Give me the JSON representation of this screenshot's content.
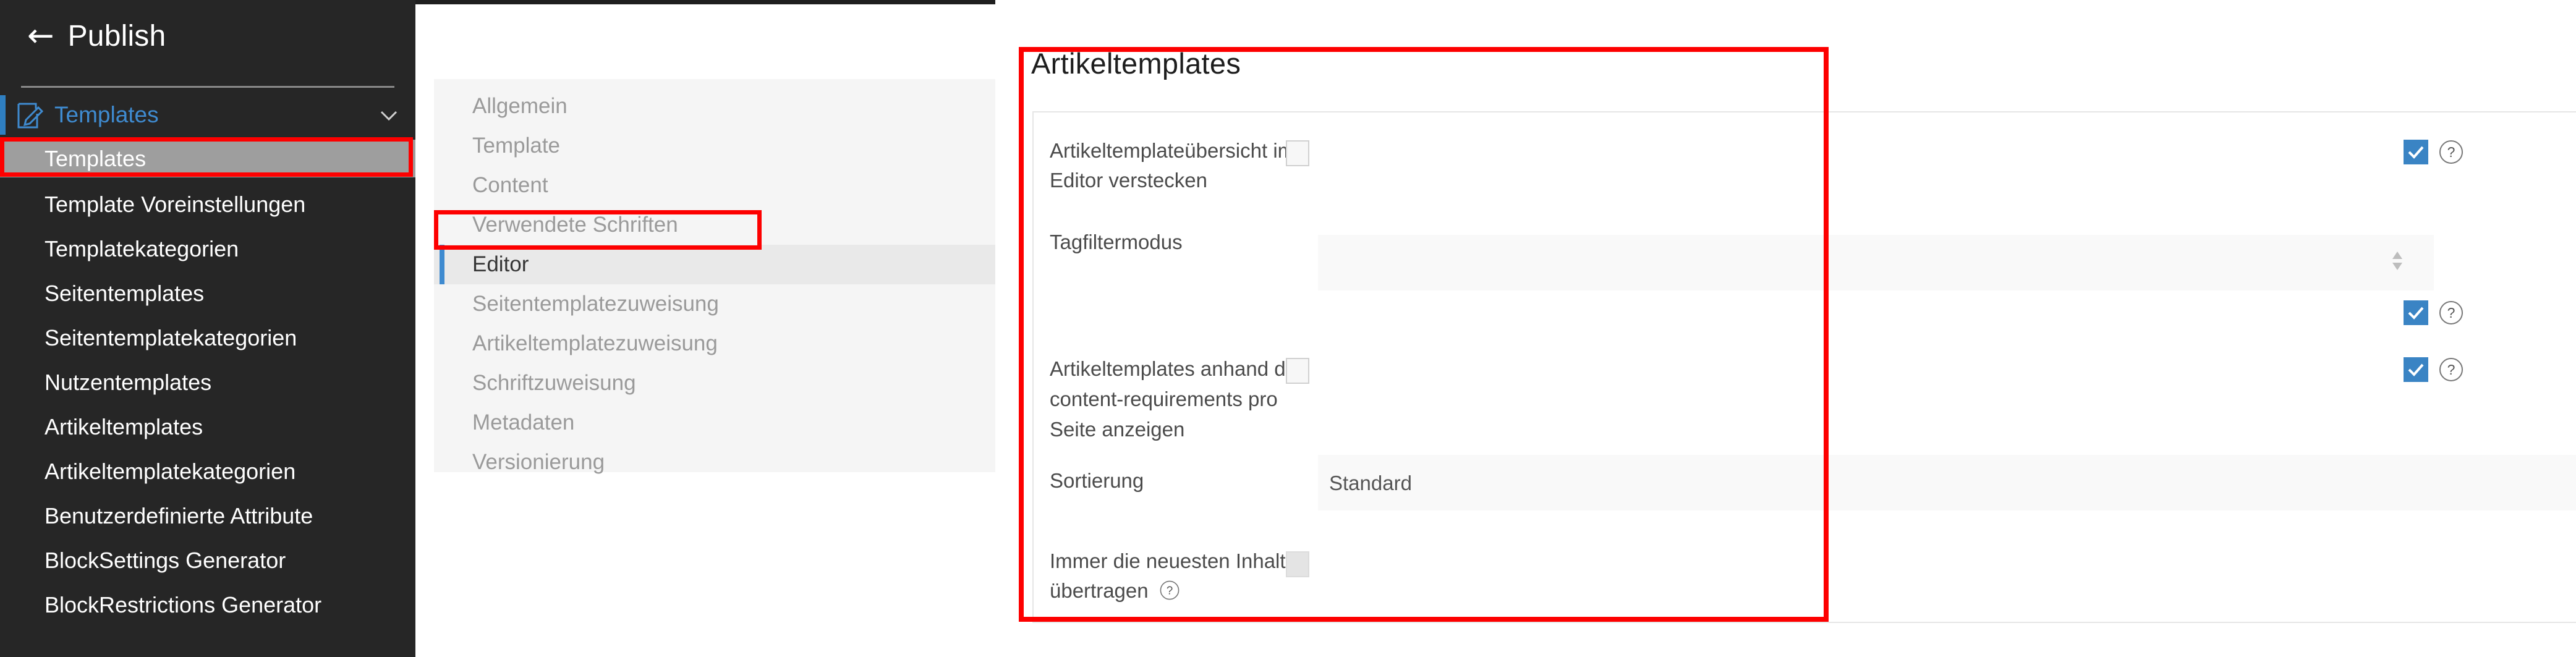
{
  "app": {
    "back_label": "Publish",
    "back_icon": "arrow-left-icon"
  },
  "sidebar": {
    "group": {
      "label": "Templates",
      "icon": "edit-document-icon",
      "chevron": "chevron-down-icon",
      "expanded": true
    },
    "items": [
      {
        "label": "Templates",
        "active": true
      },
      {
        "label": "Template Voreinstellungen",
        "active": false
      },
      {
        "label": "Templatekategorien",
        "active": false
      },
      {
        "label": "Seitentemplates",
        "active": false
      },
      {
        "label": "Seitentemplatekategorien",
        "active": false
      },
      {
        "label": "Nutzentemplates",
        "active": false
      },
      {
        "label": "Artikeltemplates",
        "active": false
      },
      {
        "label": "Artikeltemplatekategorien",
        "active": false
      },
      {
        "label": "Benutzerdefinierte Attribute",
        "active": false
      },
      {
        "label": "BlockSettings Generator",
        "active": false
      },
      {
        "label": "BlockRestrictions Generator",
        "active": false
      }
    ]
  },
  "subnav": {
    "items": [
      {
        "label": "Allgemein",
        "active": false
      },
      {
        "label": "Template",
        "active": false
      },
      {
        "label": "Content",
        "active": false
      },
      {
        "label": "Verwendete Schriften",
        "active": false
      },
      {
        "label": "Editor",
        "active": true
      },
      {
        "label": "Seitentemplatezuweisung",
        "active": false
      },
      {
        "label": "Artikeltemplatezuweisung",
        "active": false
      },
      {
        "label": "Schriftzuweisung",
        "active": false
      },
      {
        "label": "Metadaten",
        "active": false
      },
      {
        "label": "Versionierung",
        "active": false
      }
    ]
  },
  "main": {
    "title": "Artikeltemplates",
    "rows": [
      {
        "label": "Artikeltemplateübersicht im Editor verstecken",
        "control": "checkbox",
        "value": "",
        "checked": false,
        "shaded": false,
        "right_checkbox_checked": true,
        "right_help": "?"
      },
      {
        "label": "Tagfiltermodus",
        "control": "select",
        "value": "",
        "shaded": true,
        "spinner": "stepper-arrows-icon",
        "right_checkbox_checked": true,
        "right_help": "?"
      },
      {
        "label": "Artikeltemplates anhand der content-requirements pro Seite anzeigen",
        "control": "checkbox",
        "value": "",
        "checked": false,
        "shaded": false,
        "right_checkbox_checked": true,
        "right_help": "?"
      },
      {
        "label": "Sortierung",
        "control": "select",
        "value": "Standard",
        "shaded": true,
        "right_checkbox_checked": false,
        "right_help": ""
      },
      {
        "label": "Immer die neuesten Inhalte übertragen",
        "label_help": "?",
        "control": "checkbox",
        "value": "",
        "checked": false,
        "shaded": false,
        "right_checkbox_checked": false,
        "right_help": ""
      }
    ]
  },
  "highlights": {
    "sidebar_item": "Templates",
    "subnav_item": "Editor",
    "main_panel": "Artikeltemplates",
    "color": "#fd0000"
  },
  "colors": {
    "sidebar_bg": "#262626",
    "accent_blue": "#3f8bd0",
    "checkbox_blue": "#3a84c4",
    "active_sidebar_bg": "#9e9e9e",
    "panel_bg": "#f5f5f5",
    "field_bg": "#f9f9f9"
  }
}
